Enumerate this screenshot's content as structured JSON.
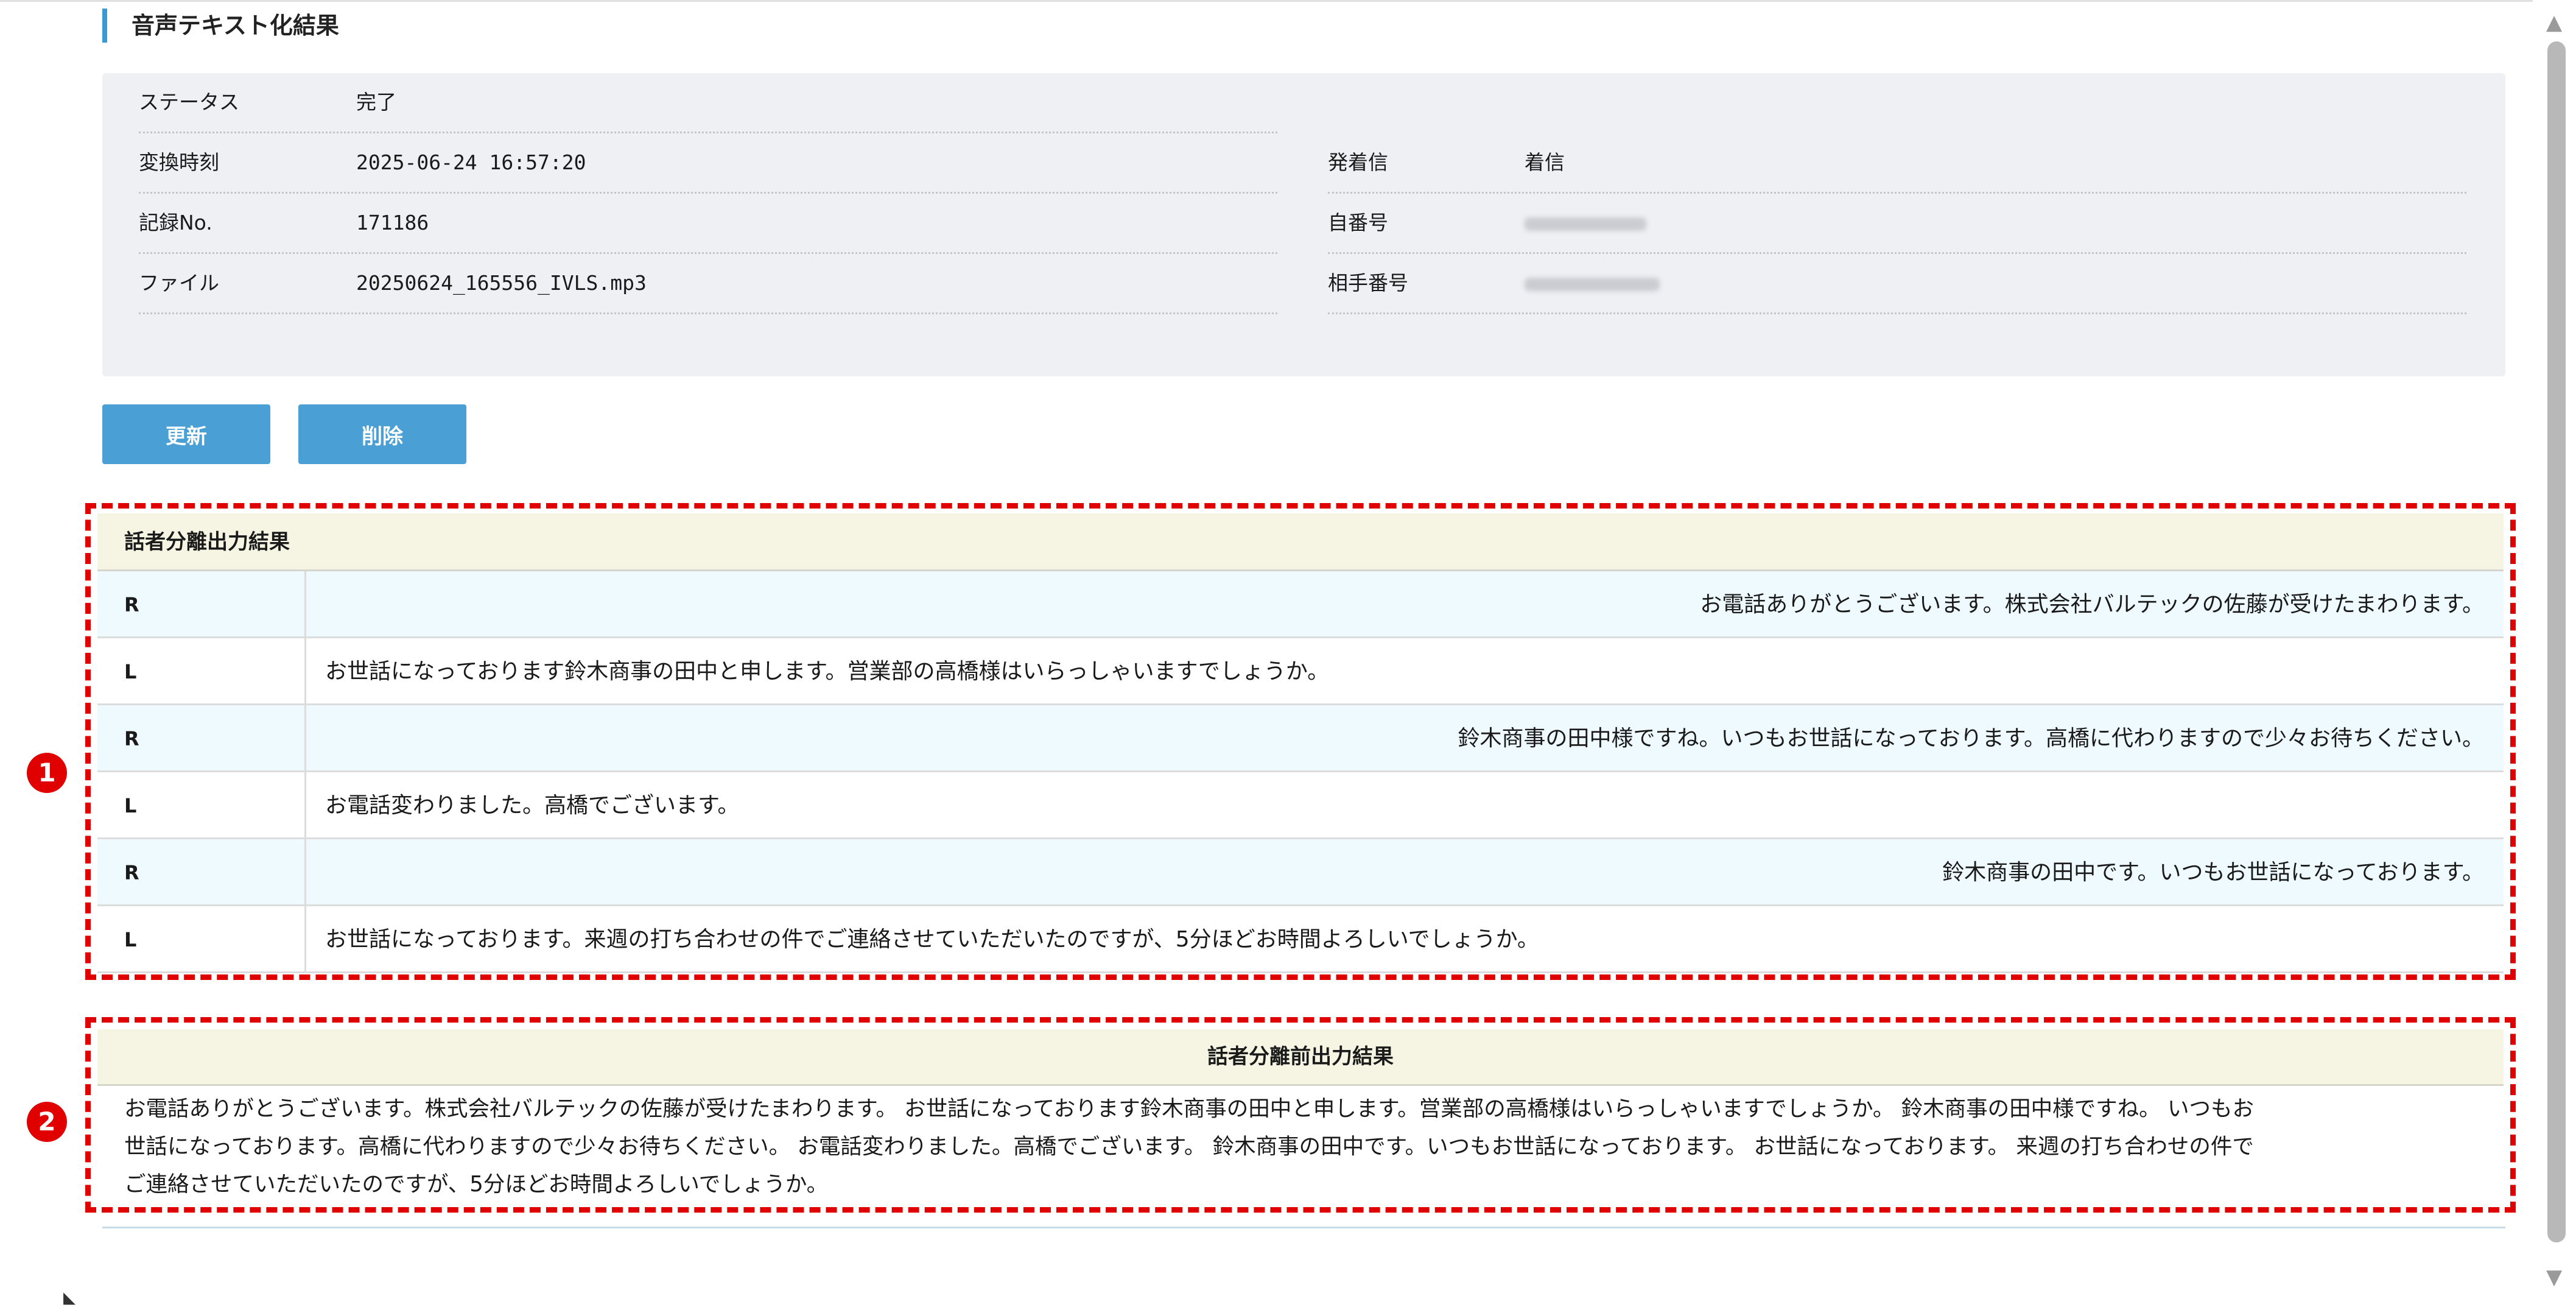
{
  "section_title": "音声テキスト化結果",
  "info": {
    "status": {
      "label": "ステータス",
      "value": "完了"
    },
    "converted_at": {
      "label": "変換時刻",
      "value": "2025-06-24 16:57:20"
    },
    "record_no": {
      "label": "記録No.",
      "value": "171186"
    },
    "file": {
      "label": "ファイル",
      "value": "20250624_165556_IVLS.mp3"
    },
    "direction": {
      "label": "発着信",
      "value": "着信"
    },
    "own_number": {
      "label": "自番号",
      "value": ""
    },
    "partner_number": {
      "label": "相手番号",
      "value": ""
    }
  },
  "buttons": {
    "update": "更新",
    "delete": "削除"
  },
  "speaker_result": {
    "title": "話者分離出力結果",
    "rows": [
      {
        "speaker": "R",
        "text": "お電話ありがとうございます。株式会社バルテックの佐藤が受けたまわります。"
      },
      {
        "speaker": "L",
        "text": "お世話になっております鈴木商事の田中と申します。営業部の高橋様はいらっしゃいますでしょうか。"
      },
      {
        "speaker": "R",
        "text": "鈴木商事の田中様ですね。いつもお世話になっております。高橋に代わりますので少々お待ちください。"
      },
      {
        "speaker": "L",
        "text": "お電話変わりました。高橋でございます。"
      },
      {
        "speaker": "R",
        "text": "鈴木商事の田中です。いつもお世話になっております。"
      },
      {
        "speaker": "L",
        "text": "お世話になっております。来週の打ち合わせの件でご連絡させていただいたのですが、5分ほどお時間よろしいでしょうか。"
      }
    ]
  },
  "raw_result": {
    "title": "話者分離前出力結果",
    "lines": [
      "お電話ありがとうございます。株式会社バルテックの佐藤が受けたまわります。 お世話になっております鈴木商事の田中と申します。営業部の高橋様はいらっしゃいますでしょうか。 鈴木商事の田中様ですね。 いつもお",
      "世話になっております。高橋に代わりますので少々お待ちください。 お電話変わりました。高橋でございます。 鈴木商事の田中です。いつもお世話になっております。 お世話になっております。 来週の打ち合わせの件で",
      "ご連絡させていただいたのですが、5分ほどお時間よろしいでしょうか。"
    ]
  },
  "markers": {
    "one": "1",
    "two": "2"
  },
  "colors": {
    "accent": "#3c9ad2",
    "button": "#4aa0d5",
    "annotation": "#e00000"
  },
  "icons": {
    "scroll_up": "scroll-up-arrow-icon",
    "scroll_down": "scroll-down-arrow-icon"
  }
}
